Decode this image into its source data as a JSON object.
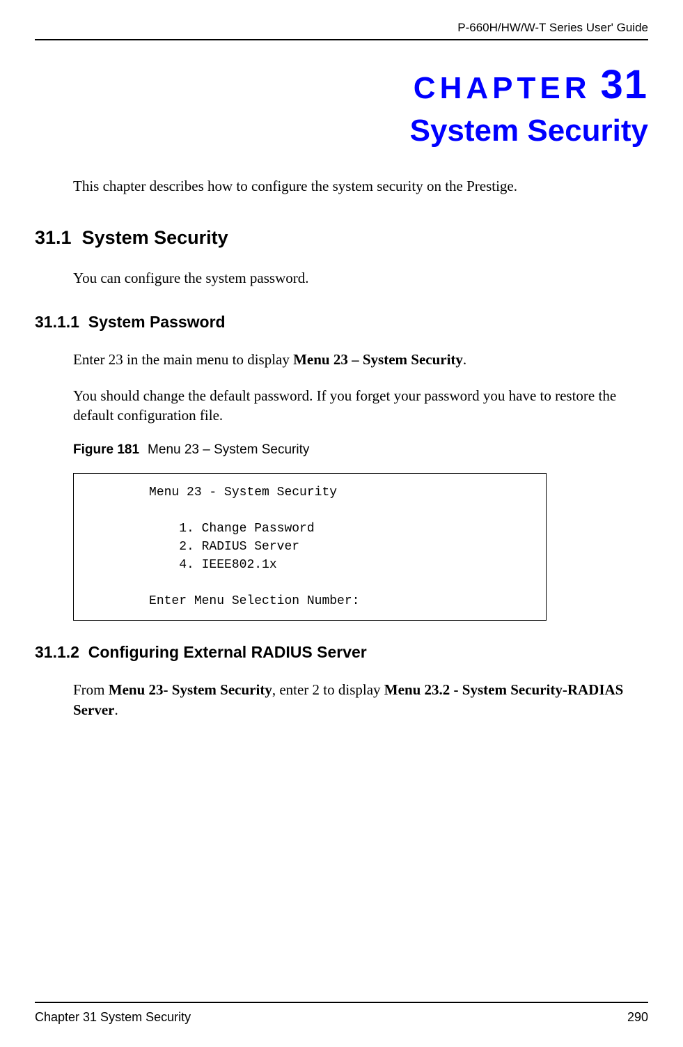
{
  "header": {
    "guide_title": "P-660H/HW/W-T Series User' Guide"
  },
  "chapter": {
    "label": "CHAPTER",
    "number": "31",
    "title": "System Security"
  },
  "intro": "This chapter describes how to configure the system security on the Prestige.",
  "section_31_1": {
    "number": "31.1",
    "title": "System Security",
    "body": "You can configure the system password."
  },
  "section_31_1_1": {
    "number": "31.1.1",
    "title": "System Password",
    "para1_prefix": "Enter 23 in the main menu to display ",
    "para1_bold": "Menu 23 – System Security",
    "para1_suffix": ".",
    "para2": "You should change the default password. If you forget your password you have to restore the default configuration file."
  },
  "figure_181": {
    "label": "Figure 181",
    "caption": "Menu 23 – System Security",
    "content": "          Menu 23 - System Security\n\n              1. Change Password\n              2. RADIUS Server\n              4. IEEE802.1x\n\n          Enter Menu Selection Number:"
  },
  "section_31_1_2": {
    "number": "31.1.2",
    "title": "Configuring External RADIUS Server",
    "para_prefix": "From ",
    "para_bold1": "Menu 23- System Security",
    "para_mid": ", enter 2 to display ",
    "para_bold2": "Menu 23.2 - System Security-RADIAS Server",
    "para_suffix": "."
  },
  "footer": {
    "chapter_ref": "Chapter 31 System Security",
    "page_number": "290"
  }
}
